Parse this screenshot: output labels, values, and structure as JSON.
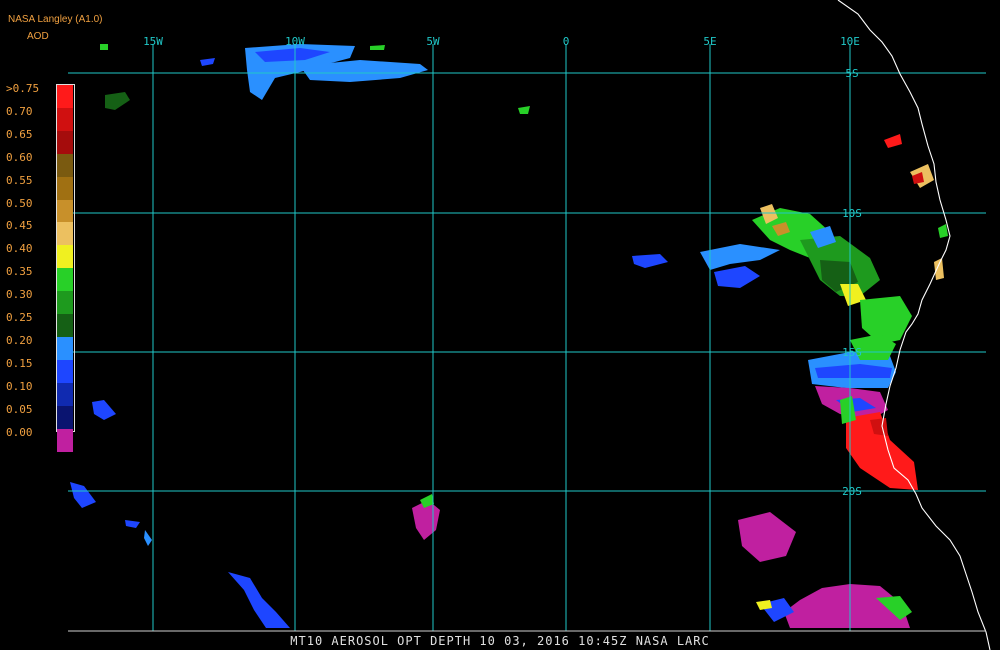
{
  "header": {
    "title": "NASA Langley (A1.0)",
    "product": "AOD"
  },
  "legend": {
    "labels": [
      ">0.75",
      "0.70",
      "0.65",
      "0.60",
      "0.55",
      "0.50",
      "0.45",
      "0.40",
      "0.35",
      "0.30",
      "0.25",
      "0.20",
      "0.15",
      "0.10",
      "0.05",
      "0.00"
    ],
    "colors": [
      "#ff1a1a",
      "#d01010",
      "#a50c0c",
      "#7a5a10",
      "#a07012",
      "#c8902a",
      "#ecc060",
      "#f0f020",
      "#28d028",
      "#1e9a1e",
      "#156015",
      "#2a90ff",
      "#1e46ff",
      "#102ab0",
      "#0a1470",
      "#c020a0"
    ]
  },
  "map": {
    "lon_labels": [
      "15W",
      "10W",
      "5W",
      "0",
      "5E",
      "10E"
    ],
    "lat_labels": [
      "5S",
      "10S",
      "15S",
      "20S"
    ],
    "grid_color": "#20c8c8",
    "coast_color": "#ffffff"
  },
  "footer": "MT10  AEROSOL OPT DEPTH   10 03, 2016 10:45Z   NASA LARC"
}
